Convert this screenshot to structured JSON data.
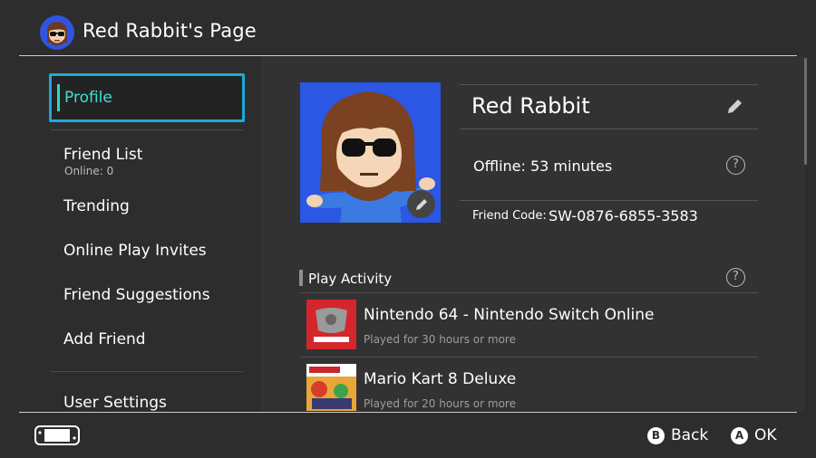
{
  "header": {
    "title": "Red Rabbit's Page"
  },
  "sidebar": {
    "items": [
      {
        "label": "Profile",
        "selected": true
      },
      {
        "label": "Friend List",
        "sub": "Online: 0"
      },
      {
        "label": "Trending"
      },
      {
        "label": "Online Play Invites"
      },
      {
        "label": "Friend Suggestions"
      },
      {
        "label": "Add Friend"
      },
      {
        "label": "User Settings"
      }
    ]
  },
  "profile": {
    "name": "Red Rabbit",
    "status": "Offline: 53 minutes",
    "friend_code_label": "Friend Code:",
    "friend_code": "SW-0876-6855-3583"
  },
  "activity": {
    "title": "Play Activity",
    "games": [
      {
        "title": "Nintendo 64 - Nintendo Switch Online",
        "time": "Played for 30 hours or more"
      },
      {
        "title": "Mario Kart 8 Deluxe",
        "time": "Played for 20 hours or more"
      }
    ]
  },
  "footer": {
    "back_glyph": "B",
    "back_label": "Back",
    "ok_glyph": "A",
    "ok_label": "OK"
  },
  "colors": {
    "accent": "#1fa9d8",
    "selected_text": "#3be3cc",
    "avatar_bg": "#2c56e4"
  },
  "icons": {
    "help": "?",
    "edit": "pencil-icon",
    "console": "switch-console-icon"
  }
}
